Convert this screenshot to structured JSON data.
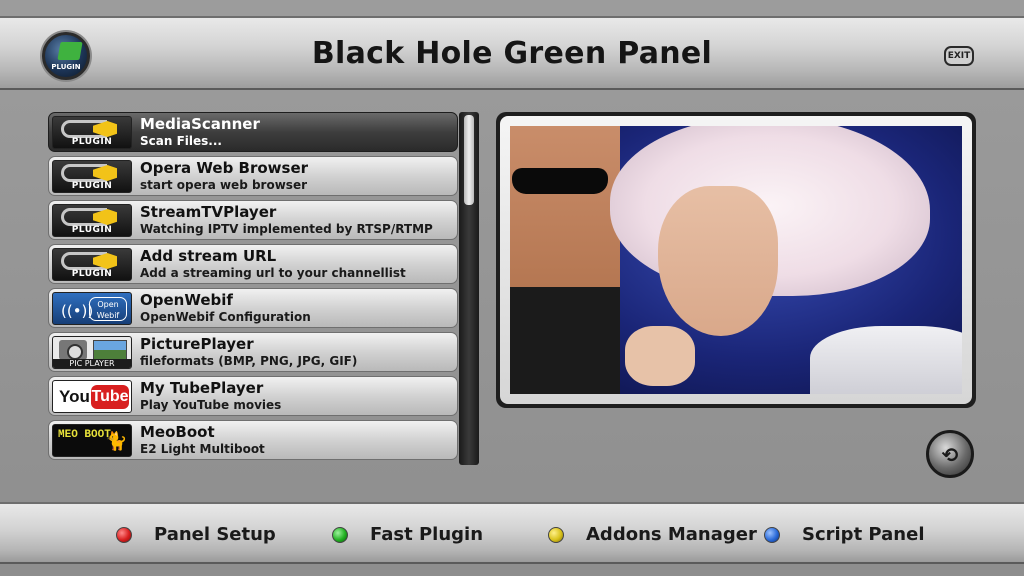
{
  "header": {
    "title": "Black Hole Green Panel",
    "plugin_badge": "PLUGIN",
    "exit_label": "EXIT"
  },
  "plugins": [
    {
      "title": "MediaScanner",
      "desc": "Scan Files...",
      "icon": "plugin-icon",
      "thumb_label": "PLUGIN",
      "selected": true
    },
    {
      "title": "Opera Web Browser",
      "desc": "start opera web browser",
      "icon": "plugin-icon",
      "thumb_label": "PLUGIN"
    },
    {
      "title": "StreamTVPlayer",
      "desc": "Watching IPTV implemented by RTSP/RTMP",
      "icon": "plugin-icon",
      "thumb_label": "PLUGIN"
    },
    {
      "title": "Add stream URL",
      "desc": "Add a streaming url to your channellist",
      "icon": "plugin-icon",
      "thumb_label": "PLUGIN"
    },
    {
      "title": "OpenWebif",
      "desc": "OpenWebif Configuration",
      "icon": "openwebif-icon",
      "thumb_label": "Open Webif"
    },
    {
      "title": "PicturePlayer",
      "desc": "fileformats (BMP, PNG, JPG, GIF)",
      "icon": "picture-player-icon",
      "thumb_label": "PIC PLAYER"
    },
    {
      "title": "My TubePlayer",
      "desc": "Play YouTube movies",
      "icon": "youtube-icon",
      "thumb_you": "You",
      "thumb_tube": "Tube"
    },
    {
      "title": "MeoBoot",
      "desc": "E2 Light Multiboot",
      "icon": "meoboot-icon",
      "thumb_label": "MEO BOOT"
    }
  ],
  "footer": {
    "buttons": [
      {
        "label": "Panel Setup",
        "color": "#d81f1f",
        "icon": "red-button-icon"
      },
      {
        "label": "Fast Plugin",
        "color": "#22b122",
        "icon": "green-button-icon"
      },
      {
        "label": "Addons Manager",
        "color": "#d9c21a",
        "icon": "yellow-button-icon"
      },
      {
        "label": "Script Panel",
        "color": "#2a6ad8",
        "icon": "blue-button-icon"
      }
    ]
  },
  "colors": {
    "selected_row": "#2a2a2a",
    "accent_green": "#3fb23f"
  }
}
